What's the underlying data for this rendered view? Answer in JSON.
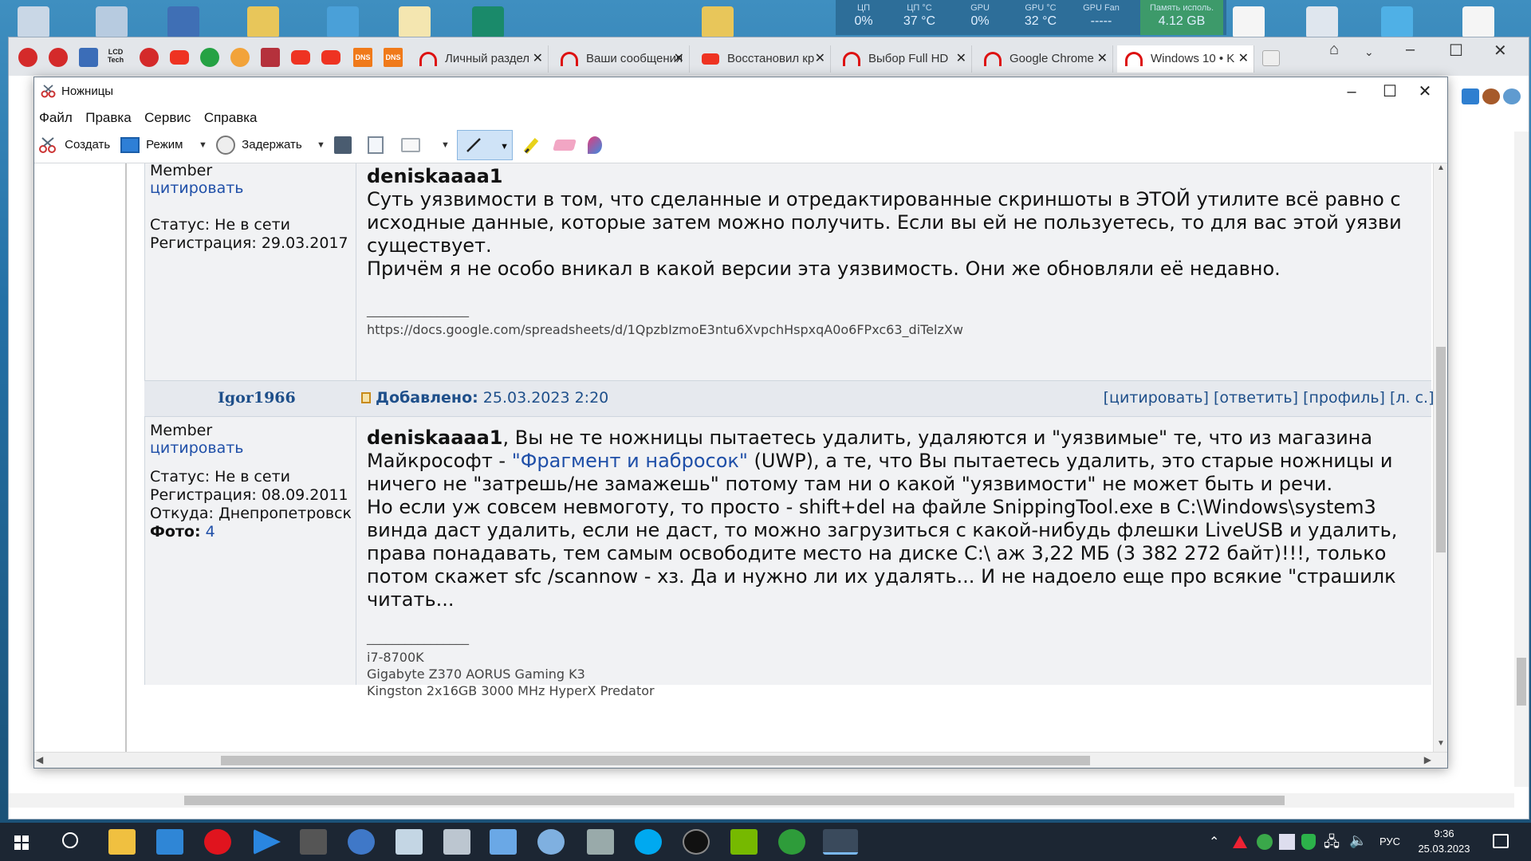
{
  "monitor": {
    "items": [
      {
        "label": "ЦП",
        "value": "0%"
      },
      {
        "label": "ЦП °C",
        "value": "37 °C"
      },
      {
        "label": "GPU",
        "value": "0%"
      },
      {
        "label": "GPU °C",
        "value": "32 °C"
      },
      {
        "label": "GPU Fan",
        "value": "-----"
      },
      {
        "label": "Память исполь.",
        "value": "4.12 GB"
      }
    ]
  },
  "browser": {
    "pinned_icons": [
      "opera-red-icon",
      "opera-red-icon",
      "lcd-icon",
      "lcd-tech-icon",
      "opera-red-icon",
      "youtube-icon",
      "whatsapp-icon",
      "colorful-app-icon",
      "audio-icon",
      "youtube-icon",
      "youtube-icon",
      "dns-icon",
      "dns-icon"
    ],
    "lcd_tech_label": "LCD Tech",
    "dns_label": "DNS",
    "tabs": [
      {
        "title": "Личный раздел",
        "active": false
      },
      {
        "title": "Ваши сообщения",
        "active": false
      },
      {
        "title": "Восстановил кр",
        "active": false
      },
      {
        "title": "Выбор Full HD",
        "active": false
      },
      {
        "title": "Google Chrome",
        "active": false
      },
      {
        "title": "Windows 10 • K",
        "active": true
      }
    ]
  },
  "snip": {
    "title": "Ножницы",
    "menu": [
      "Файл",
      "Правка",
      "Сервис",
      "Справка"
    ],
    "toolbar": {
      "create": "Создать",
      "mode": "Режим",
      "delay": "Задержать"
    }
  },
  "posts": [
    {
      "role": "Member",
      "quote": "цитировать",
      "status": "Статус: Не в сети",
      "registered": "Регистрация: 29.03.2017",
      "author": "deniskaaaa1",
      "lines": [
        "Суть уязвимости в том, что сделанные и отредактированные скриншоты в ЭТОЙ утилите всё равно с",
        "исходные данные, которые затем можно получить. Если вы ей не пользуетесь, то для вас этой уязви",
        "существует.",
        "Причём я не особо вникал в какой версии эта уязвимость. Они же обновляли её недавно."
      ],
      "separator": "________________",
      "signature": [
        "https://docs.google.com/spreadsheets/d/1QpzbIzmoE3ntu6XvpchHspxqA0o6FPxc63_diTelzXw"
      ]
    },
    {
      "username": "Igor1966",
      "added_label": "Добавлено:",
      "added_date": "25.03.2023 2:20",
      "links": "[цитировать] [ответить] [профиль] [л. с.] [Ч",
      "role": "Member",
      "quote": "цитировать",
      "status": "Статус: Не в сети",
      "registered": "Регистрация: 08.09.2011",
      "from": "Откуда: Днепропетровск",
      "photo_label": "Фото:",
      "photo_count": "4",
      "author": "deniskaaaa1",
      "first_line_rest": ", Вы не те ножницы пытаетесь удалить, удаляются и \"уязвимые\" те, что из магазина",
      "line2_pre": "Майкрософт - ",
      "line2_link": "\"Фрагмент и набросок\"",
      "line2_post": " (UWP), а те, что Вы пытаетесь удалить, это старые ножницы и",
      "lines": [
        "ничего не \"затрешь/не замажешь\" потому там ни о какой \"уязвимости\" не может быть и речи.",
        "Но если уж совсем невмоготу, то просто - shift+del на файле SnippingTool.exe в C:\\Windows\\system3",
        "винда даст удалить, если не даст, то можно загрузиться с какой-нибудь флешки LiveUSB и удалить,",
        "права понадавать, тем самым освободите место на диске C:\\ аж 3,22 МБ (3 382 272 байт)!!!, только",
        "потом скажет sfc /scannow - хз. Да и нужно ли их удалять... И не надоело еще про всякие \"страшилк",
        "читать..."
      ],
      "separator": "________________",
      "signature": [
        "i7-8700K",
        "Gigabyte Z370 AORUS Gaming K3",
        "Kingston 2x16GB 3000 MHz HyperX Predator"
      ]
    }
  ],
  "taskbar": {
    "lang": "РУС",
    "time": "9:36",
    "date": "25.03.2023"
  },
  "colors": {
    "link": "#1f4fa8",
    "post_bg": "#f1f2f4",
    "taskbar": "#1c2633",
    "mem_bg": "#3d9a6a"
  }
}
